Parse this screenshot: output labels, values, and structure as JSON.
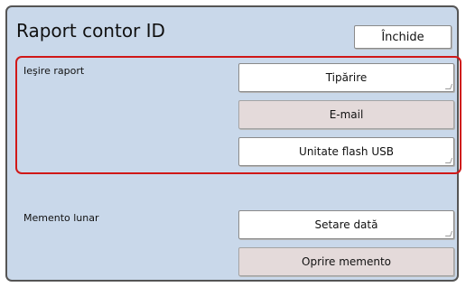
{
  "header": {
    "title": "Raport contor ID",
    "close_label": "Închide"
  },
  "output_section": {
    "label": "Ieşire raport",
    "buttons": {
      "print": "Tipărire",
      "email": "E-mail",
      "usb": "Unitate flash USB"
    }
  },
  "memento_section": {
    "label": "Memento lunar",
    "buttons": {
      "set_date": "Setare dată",
      "stop": "Oprire memento"
    }
  },
  "colors": {
    "panel_background": "#c9d8ea",
    "highlight_border": "#d01818",
    "disabled_button": "#e4dada"
  }
}
